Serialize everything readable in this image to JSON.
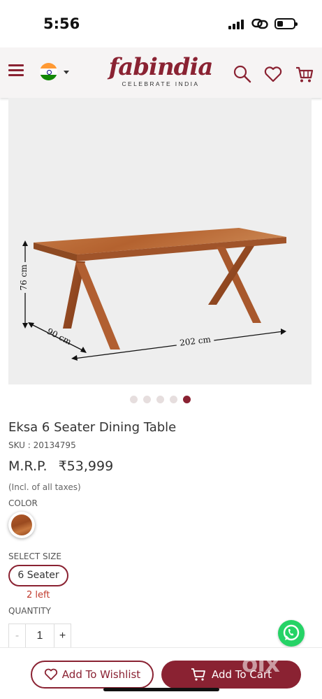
{
  "status_bar": {
    "time": "5:56"
  },
  "header": {
    "brand_name": "fabindia",
    "brand_tagline": "CELEBRATE INDIA",
    "icons": [
      "menu-icon",
      "india-flag-icon",
      "search-icon",
      "heart-icon",
      "cart-icon"
    ]
  },
  "gallery": {
    "dimensions": {
      "height": "76 cm",
      "depth": "90 cm",
      "length": "202 cm"
    },
    "dots_total": 5,
    "dots_active_index": 4
  },
  "product": {
    "title": "Eksa 6 Seater Dining Table",
    "sku": "SKU : 20134795",
    "mrp_label": "M.R.P.",
    "price": "₹53,999",
    "tax_note": "(Incl. of all taxes)",
    "color_label": "COLOR",
    "size_label": "SELECT SIZE",
    "size_selected": "6 Seater",
    "stock_note": "2 left",
    "quantity_label": "QUANTITY",
    "quantity_minus": "-",
    "quantity_value": "1",
    "quantity_plus": "+"
  },
  "actions": {
    "wishlist_label": "Add To Wishlist",
    "cart_label": "Add To Cart"
  },
  "watermark": "olx",
  "colors": {
    "brand": "#8a2232",
    "whatsapp": "#25d366",
    "stock_alert": "#c0392b"
  }
}
